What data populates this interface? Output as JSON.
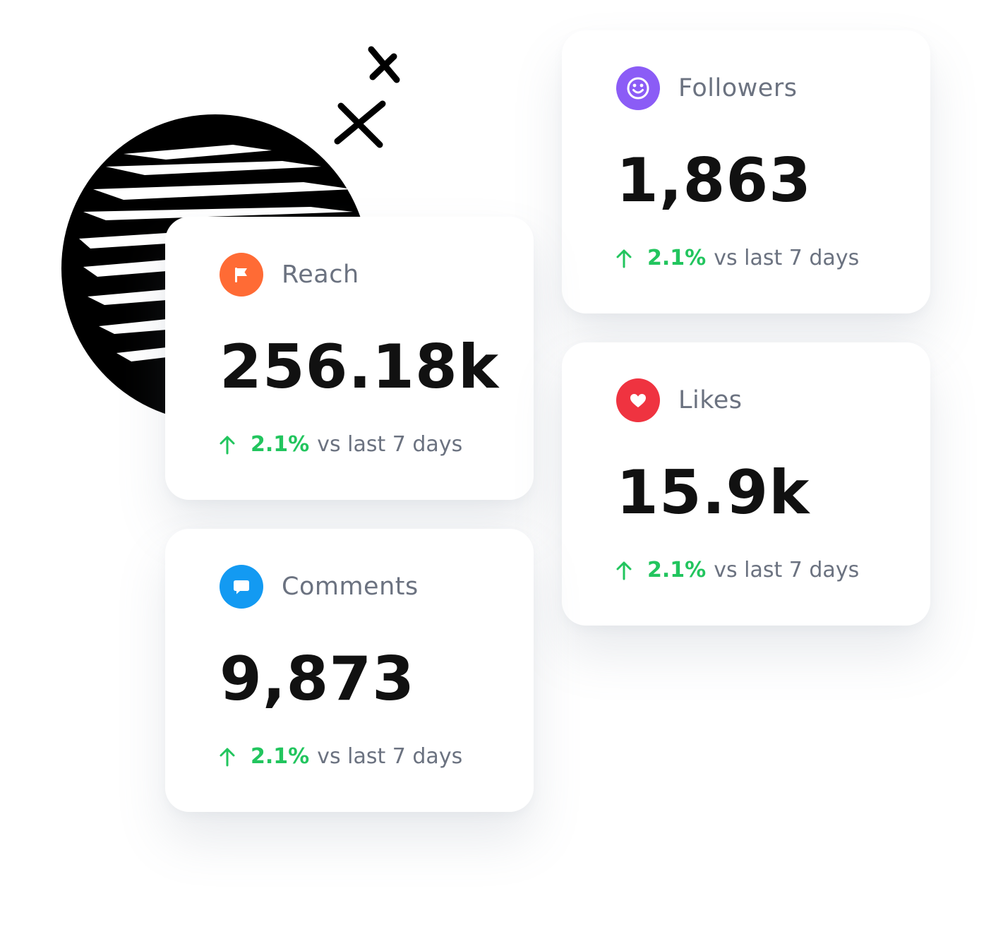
{
  "colors": {
    "positive": "#22c55e",
    "label": "#6b7280",
    "value": "#111111"
  },
  "cards": {
    "followers": {
      "label": "Followers",
      "value": "1,863",
      "change": "2.1%",
      "period": "vs last 7 days",
      "icon": "smiley-icon",
      "icon_color": "#8b5cf6"
    },
    "reach": {
      "label": "Reach",
      "value": "256.18k",
      "change": "2.1%",
      "period": "vs last 7 days",
      "icon": "flag-icon",
      "icon_color": "#ff6b35"
    },
    "likes": {
      "label": "Likes",
      "value": "15.9k",
      "change": "2.1%",
      "period": "vs last 7 days",
      "icon": "heart-icon",
      "icon_color": "#ef3340"
    },
    "comments": {
      "label": "Comments",
      "value": "9,873",
      "change": "2.1%",
      "period": "vs last 7 days",
      "icon": "speech-bubble-icon",
      "icon_color": "#139af2"
    }
  }
}
